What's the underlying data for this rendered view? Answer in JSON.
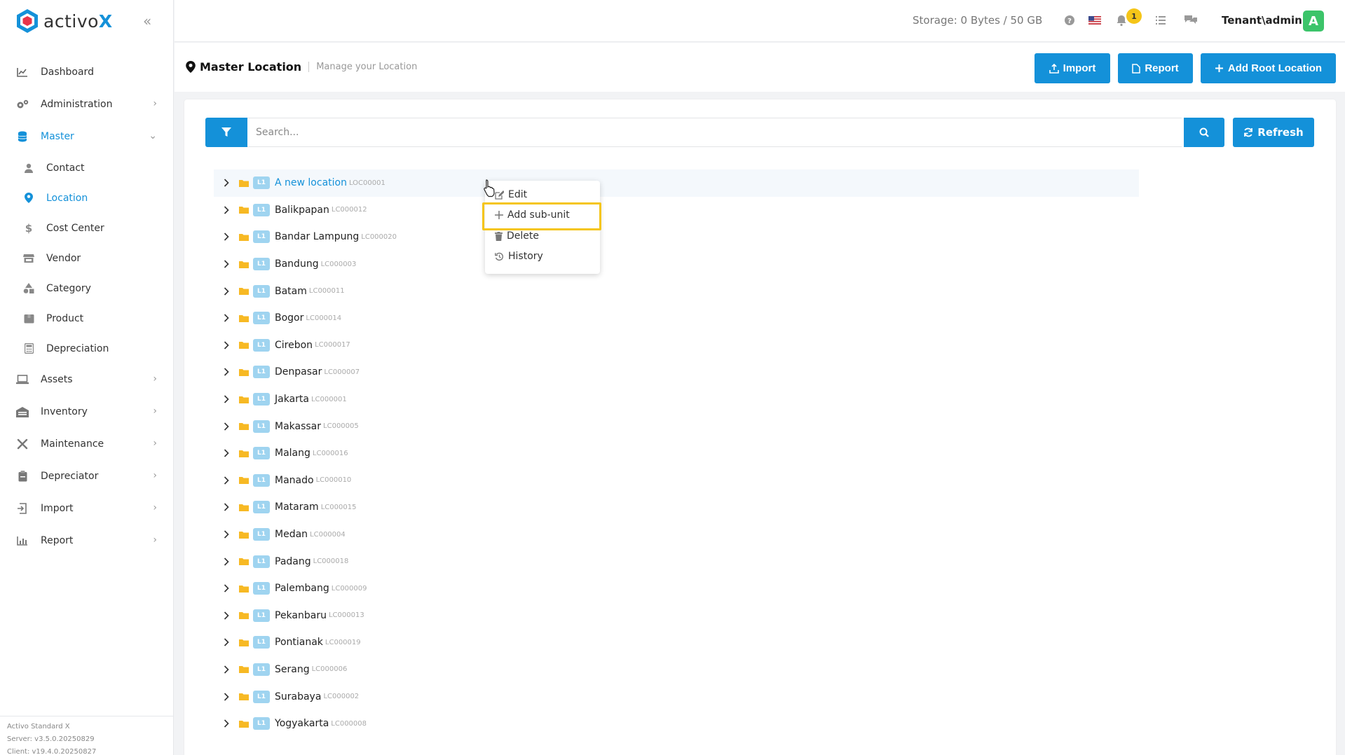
{
  "brand": {
    "name": "activo",
    "x": "X"
  },
  "sidebar": {
    "items": [
      {
        "label": "Dashboard",
        "icon": "chart-line-icon",
        "has_children": false
      },
      {
        "label": "Administration",
        "icon": "cogs-icon",
        "has_children": true
      },
      {
        "label": "Master",
        "icon": "database-icon",
        "has_children": true,
        "expanded": true
      },
      {
        "label": "Assets",
        "icon": "laptop-icon",
        "has_children": true
      },
      {
        "label": "Inventory",
        "icon": "warehouse-icon",
        "has_children": true
      },
      {
        "label": "Maintenance",
        "icon": "tools-icon",
        "has_children": true
      },
      {
        "label": "Depreciator",
        "icon": "clipboard-icon",
        "has_children": true
      },
      {
        "label": "Import",
        "icon": "import-icon",
        "has_children": true
      },
      {
        "label": "Report",
        "icon": "chart-bar-icon",
        "has_children": true
      }
    ],
    "master_children": [
      {
        "label": "Contact",
        "icon": "user-icon"
      },
      {
        "label": "Location",
        "icon": "map-marker-icon",
        "active": true
      },
      {
        "label": "Cost Center",
        "icon": "dollar-icon"
      },
      {
        "label": "Vendor",
        "icon": "store-icon"
      },
      {
        "label": "Category",
        "icon": "shapes-icon"
      },
      {
        "label": "Product",
        "icon": "box-icon"
      },
      {
        "label": "Depreciation",
        "icon": "calculator-icon"
      }
    ],
    "footer": {
      "product": "Activo Standard X",
      "server": "Server: v3.5.0.20250829",
      "client": "Client: v19.4.0.20250827"
    }
  },
  "topbar": {
    "storage": "Storage: 0 Bytes / 50 GB",
    "notification_count": "1",
    "user": "Tenant\\admin",
    "avatar_letter": "A"
  },
  "header": {
    "title": "Master Location",
    "subtitle": "Manage your Location",
    "import_label": "Import",
    "report_label": "Report",
    "add_root_label": "Add Root Location"
  },
  "search": {
    "placeholder": "Search...",
    "refresh_label": "Refresh"
  },
  "tree": {
    "level_badge": "L1",
    "rows": [
      {
        "name": "A new location",
        "code": "LOC00001"
      },
      {
        "name": "Balikpapan",
        "code": "LC000012"
      },
      {
        "name": "Bandar Lampung",
        "code": "LC000020"
      },
      {
        "name": "Bandung",
        "code": "LC000003"
      },
      {
        "name": "Batam",
        "code": "LC000011"
      },
      {
        "name": "Bogor",
        "code": "LC000014"
      },
      {
        "name": "Cirebon",
        "code": "LC000017"
      },
      {
        "name": "Denpasar",
        "code": "LC000007"
      },
      {
        "name": "Jakarta",
        "code": "LC000001"
      },
      {
        "name": "Makassar",
        "code": "LC000005"
      },
      {
        "name": "Malang",
        "code": "LC000016"
      },
      {
        "name": "Manado",
        "code": "LC000010"
      },
      {
        "name": "Mataram",
        "code": "LC000015"
      },
      {
        "name": "Medan",
        "code": "LC000004"
      },
      {
        "name": "Padang",
        "code": "LC000018"
      },
      {
        "name": "Palembang",
        "code": "LC000009"
      },
      {
        "name": "Pekanbaru",
        "code": "LC000013"
      },
      {
        "name": "Pontianak",
        "code": "LC000019"
      },
      {
        "name": "Serang",
        "code": "LC000006"
      },
      {
        "name": "Surabaya",
        "code": "LC000002"
      },
      {
        "name": "Yogyakarta",
        "code": "LC000008"
      }
    ]
  },
  "context_menu": {
    "edit": "Edit",
    "add_sub_unit": "Add sub-unit",
    "delete": "Delete",
    "history": "History"
  },
  "colors": {
    "accent": "#1491d9",
    "highlight": "#f5c518",
    "folder": "#f7b924",
    "avatar": "#3cc46a"
  }
}
